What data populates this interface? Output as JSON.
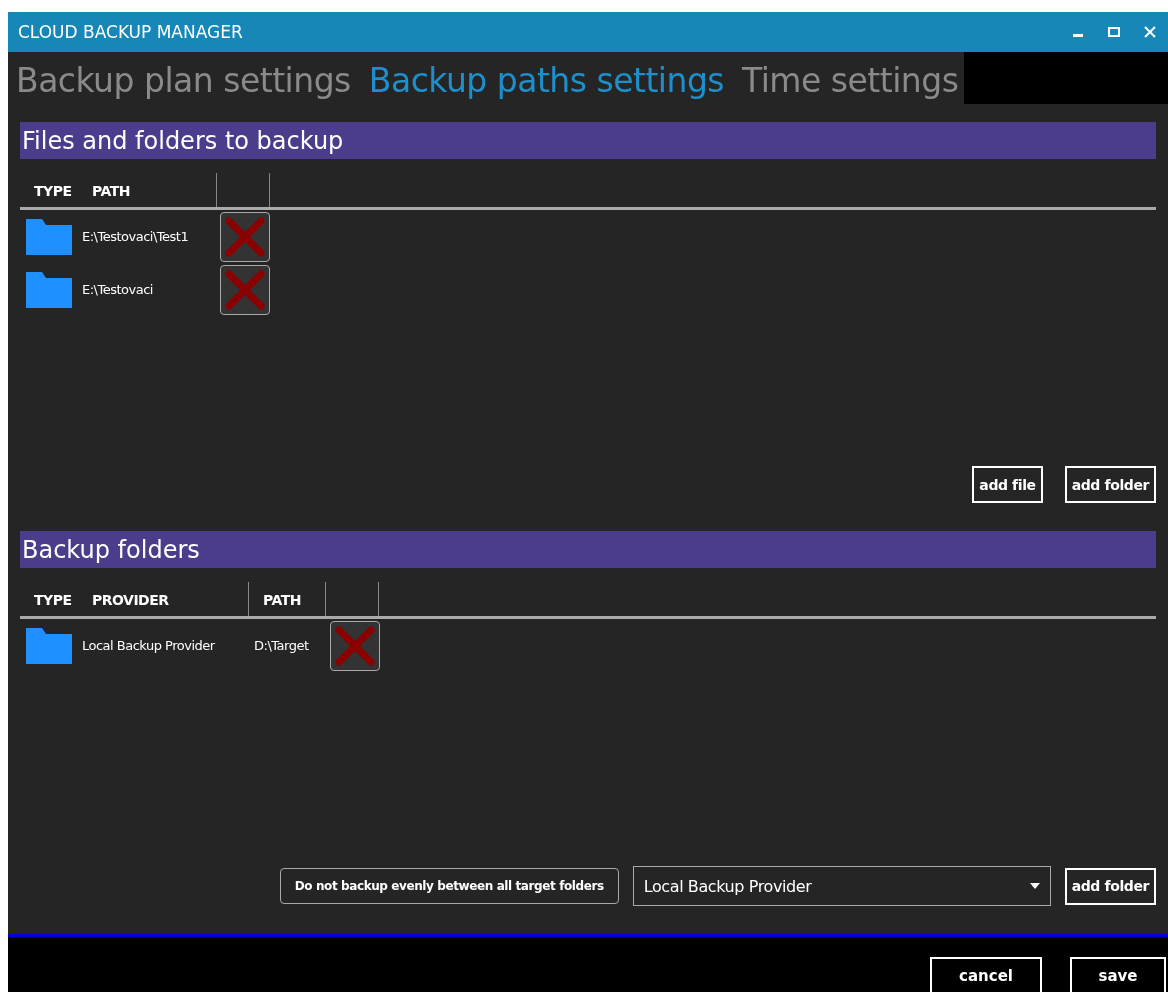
{
  "window": {
    "title": "CLOUD BACKUP MANAGER"
  },
  "tabs": [
    {
      "label": "Backup plan settings",
      "selected": false
    },
    {
      "label": "Backup paths settings",
      "selected": true
    },
    {
      "label": "Time settings",
      "selected": false
    }
  ],
  "sources": {
    "title": "Files and folders to backup",
    "columns": [
      "TYPE",
      "PATH"
    ],
    "rows": [
      {
        "path": "E:\\Testovaci\\Test1"
      },
      {
        "path": "E:\\Testovaci"
      }
    ],
    "buttons": [
      "add file",
      "add folder"
    ]
  },
  "targets": {
    "title": "Backup folders",
    "columns": [
      "TYPE",
      "PROVIDER",
      "PATH"
    ],
    "rows": [
      {
        "provider": "Local Backup Provider",
        "path": "D:\\Target"
      }
    ],
    "distribute_button": "Do not backup evenly between all target folders",
    "provider_dropdown": {
      "value": "Local Backup Provider"
    },
    "add_button": "add folder"
  },
  "footer_buttons": [
    "cancel",
    "save"
  ]
}
